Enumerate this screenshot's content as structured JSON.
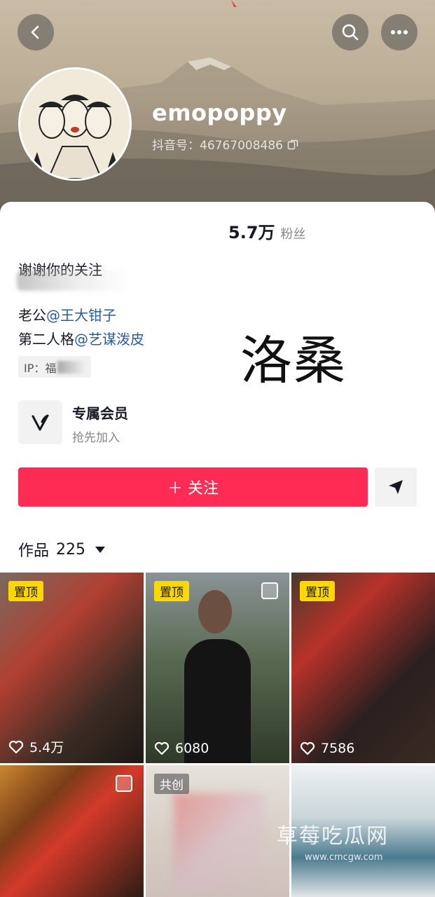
{
  "header": {
    "username": "emopoppy",
    "douyin_id": "抖音号：46767008486"
  },
  "stats": {
    "fans_count": "5.7万",
    "fans_label": "粉丝"
  },
  "bio": {
    "line1": "谢谢你的关注",
    "husband_label": "老公",
    "husband_mention": "@王大钳子",
    "second_label": "第二人格",
    "second_mention": "@艺谋泼皮",
    "ip_label": "IP：福"
  },
  "overlay_name": "洛桑",
  "membership": {
    "title": "专属会员",
    "subtitle": "抢先加入"
  },
  "actions": {
    "follow_label": "＋ 关注"
  },
  "works": {
    "label": "作品",
    "count": "225"
  },
  "grid": {
    "items": [
      {
        "tag": "置顶",
        "likes": "5.4万"
      },
      {
        "tag": "置顶",
        "likes": "6080"
      },
      {
        "tag": "置顶",
        "likes": "7586"
      },
      {
        "tag": "",
        "likes": ""
      },
      {
        "tag": "共创",
        "likes": ""
      },
      {
        "tag": "",
        "likes": ""
      }
    ]
  },
  "watermark": {
    "title": "草莓吃瓜网",
    "url": "www.cmcgw.com"
  },
  "colors": {
    "follow": "#fe2c55",
    "pin_tag": "#fbd800",
    "mention": "#2b5c9b"
  }
}
